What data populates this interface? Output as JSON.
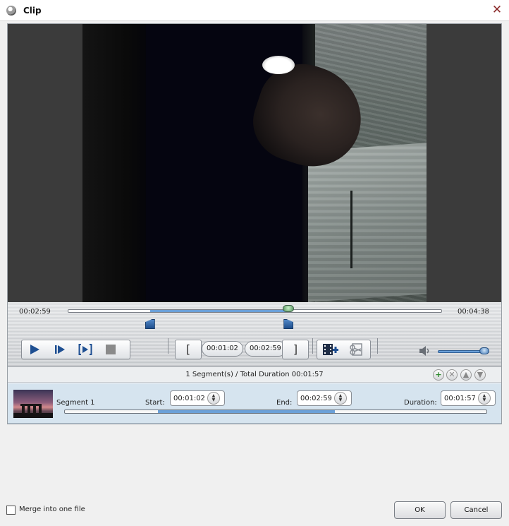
{
  "window": {
    "title": "Clip",
    "close_icon": "close-icon"
  },
  "player": {
    "current_time": "00:02:59",
    "total_time": "00:04:38",
    "position": 0.59,
    "range_start": 0.22,
    "range_end": 0.59,
    "volume": 0.92
  },
  "toolbar": {
    "play_icon": "play-icon",
    "step_icon": "step-forward-icon",
    "next_frame_icon": "next-frame-icon",
    "stop_icon": "stop-icon",
    "set_start_label": "[",
    "set_end_label": "]",
    "start_time": "00:01:02",
    "end_time": "00:02:59",
    "add_segment_icon": "add-segment-icon",
    "cut_icon": "cut-icon",
    "volume_icon": "speaker-icon"
  },
  "segments": {
    "summary": "1 Segment(s) / Total Duration 00:01:57",
    "add_icon": "add-icon",
    "remove_icon": "remove-icon",
    "up_icon": "up-icon",
    "down_icon": "down-icon",
    "items": [
      {
        "name": "Segment 1",
        "start_label": "Start:",
        "start": "00:01:02",
        "end_label": "End:",
        "end": "00:02:59",
        "duration_label": "Duration:",
        "duration": "00:01:57",
        "range_start": 0.22,
        "range_end": 0.64
      }
    ]
  },
  "footer": {
    "merge_label": "Merge into one file",
    "merge_checked": false,
    "ok_label": "OK",
    "cancel_label": "Cancel"
  },
  "colors": {
    "accent": "#6aa0d8",
    "marker": "#1f4f8d",
    "close": "#8b2a2a"
  }
}
